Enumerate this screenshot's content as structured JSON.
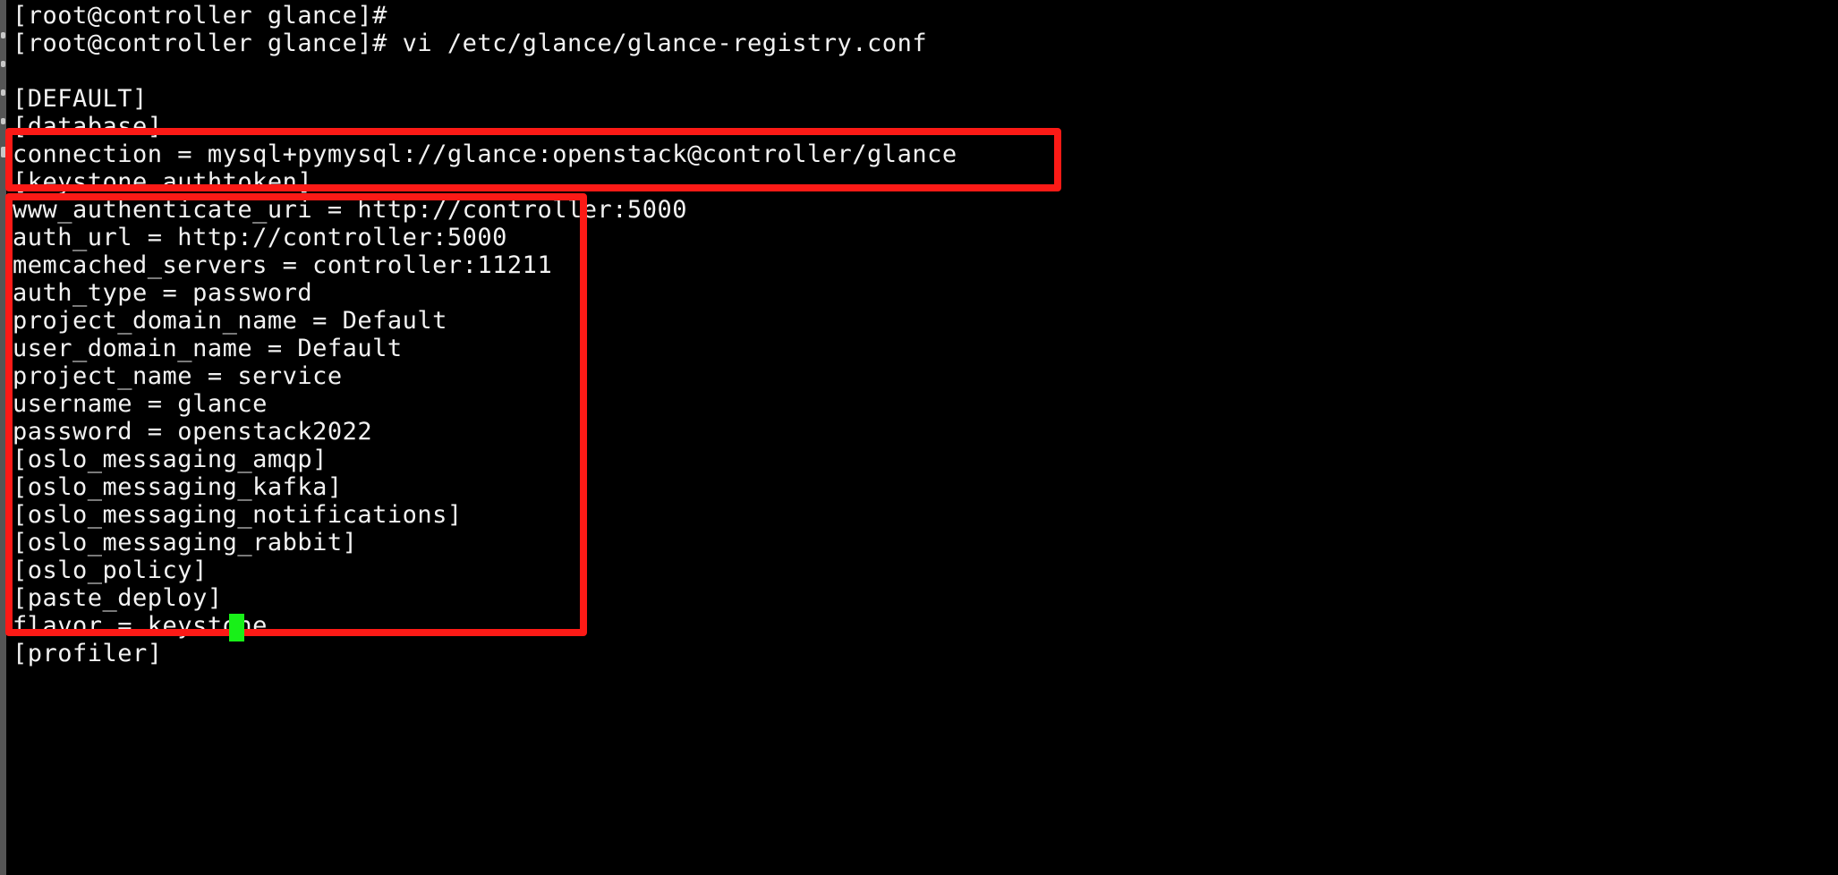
{
  "window": {
    "type": "terminal",
    "background_color": "#000000",
    "foreground_color": "#f2f2f2",
    "edge_strip_color": "#555555"
  },
  "annotations": {
    "box_color": "#fc1a16",
    "cursor_color": "#18f018",
    "box_1_label": "database-connection-highlight",
    "box_2_label": "keystone-authtoken-block-highlight"
  },
  "terminal": {
    "lines": [
      {
        "id": "prompt-1",
        "text": "[root@controller glance]#"
      },
      {
        "id": "prompt-2",
        "text": "[root@controller glance]# vi /etc/glance/glance-registry.conf"
      },
      {
        "id": "blank-1",
        "text": ""
      },
      {
        "id": "sec-default",
        "text": "[DEFAULT]"
      },
      {
        "id": "sec-database",
        "text": "[database]"
      },
      {
        "id": "cfg-connection",
        "text": "connection = mysql+pymysql://glance:openstack@controller/glance"
      },
      {
        "id": "sec-keystone-authtoken",
        "text": "[keystone_authtoken]"
      },
      {
        "id": "cfg-www-auth-uri",
        "text": "www_authenticate_uri = http://controller:5000"
      },
      {
        "id": "cfg-auth-url",
        "text": "auth_url = http://controller:5000"
      },
      {
        "id": "cfg-memcached",
        "text": "memcached_servers = controller:11211"
      },
      {
        "id": "cfg-auth-type",
        "text": "auth_type = password"
      },
      {
        "id": "cfg-project-domain",
        "text": "project_domain_name = Default"
      },
      {
        "id": "cfg-user-domain",
        "text": "user_domain_name = Default"
      },
      {
        "id": "cfg-project-name",
        "text": "project_name = service"
      },
      {
        "id": "cfg-username",
        "text": "username = glance"
      },
      {
        "id": "cfg-password",
        "text": "password = openstack2022"
      },
      {
        "id": "sec-oslo-amqp",
        "text": "[oslo_messaging_amqp]"
      },
      {
        "id": "sec-oslo-kafka",
        "text": "[oslo_messaging_kafka]"
      },
      {
        "id": "sec-oslo-notifications",
        "text": "[oslo_messaging_notifications]"
      },
      {
        "id": "sec-oslo-rabbit",
        "text": "[oslo_messaging_rabbit]"
      },
      {
        "id": "sec-oslo-policy",
        "text": "[oslo_policy]"
      },
      {
        "id": "sec-paste-deploy",
        "text": "[paste_deploy]"
      },
      {
        "id": "cfg-flavor",
        "text": "flavor = keystone"
      },
      {
        "id": "sec-profiler",
        "text": "[profiler]"
      }
    ],
    "hostname": "controller",
    "user": "root",
    "cwd": "glance",
    "prompt_symbol": "#",
    "command": "vi /etc/glance/glance-registry.conf",
    "edited_file": "/etc/glance/glance-registry.conf"
  }
}
